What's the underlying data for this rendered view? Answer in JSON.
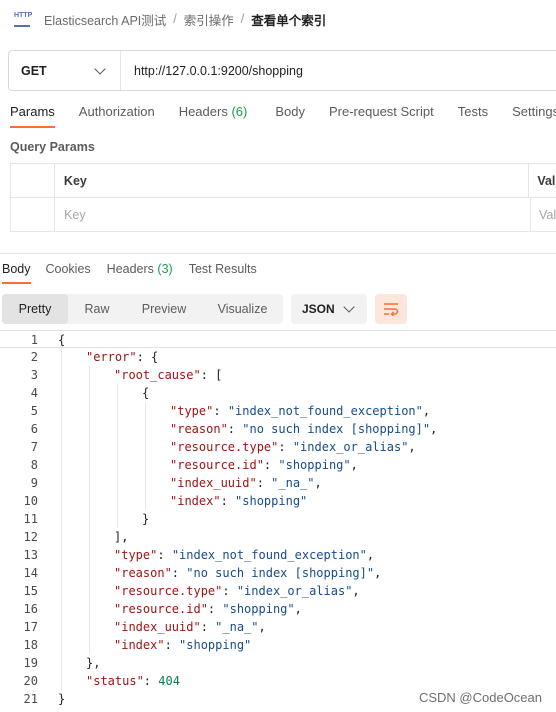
{
  "breadcrumb": {
    "badge": "HTTP",
    "items": [
      "Elasticsearch API测试",
      "索引操作"
    ],
    "separator": "/",
    "current": "查看单个索引"
  },
  "request": {
    "method": "GET",
    "url": "http://127.0.0.1:9200/shopping"
  },
  "request_tabs": [
    {
      "label": "Params",
      "active": true
    },
    {
      "label": "Authorization"
    },
    {
      "label": "Headers",
      "count": "(6)"
    },
    {
      "label": "Body"
    },
    {
      "label": "Pre-request Script"
    },
    {
      "label": "Tests"
    },
    {
      "label": "Settings"
    }
  ],
  "query_params": {
    "title": "Query Params",
    "headers": [
      "Key",
      "Value"
    ],
    "placeholders": [
      "Key",
      "Value"
    ]
  },
  "response_tabs": [
    {
      "label": "Body",
      "active": true
    },
    {
      "label": "Cookies"
    },
    {
      "label": "Headers",
      "count": "(3)"
    },
    {
      "label": "Test Results"
    }
  ],
  "view_modes": [
    "Pretty",
    "Raw",
    "Preview",
    "Visualize"
  ],
  "active_view": "Pretty",
  "format": "JSON",
  "icons": {
    "badge": "http-icon",
    "method": "chevron-down-icon",
    "format": "chevron-down-icon",
    "wrap": "wrap-lines-icon"
  },
  "colors": {
    "accent": "#ff6c37",
    "count": "#1a9e4b",
    "json_key": "#9c1313",
    "json_string": "#184c8a",
    "json_number": "#0d7a4e"
  },
  "code_lines": [
    [
      [
        "p",
        "{"
      ]
    ],
    [
      [
        "k",
        "\"error\""
      ],
      [
        "p",
        ": {"
      ]
    ],
    [
      [
        "k",
        "\"root_cause\""
      ],
      [
        "p",
        ": ["
      ]
    ],
    [
      [
        "p",
        "{"
      ]
    ],
    [
      [
        "k",
        "\"type\""
      ],
      [
        "p",
        ": "
      ],
      [
        "s",
        "\"index_not_found_exception\""
      ],
      [
        "p",
        ","
      ]
    ],
    [
      [
        "k",
        "\"reason\""
      ],
      [
        "p",
        ": "
      ],
      [
        "s",
        "\"no such index [shopping]\""
      ],
      [
        "p",
        ","
      ]
    ],
    [
      [
        "k",
        "\"resource.type\""
      ],
      [
        "p",
        ": "
      ],
      [
        "s",
        "\"index_or_alias\""
      ],
      [
        "p",
        ","
      ]
    ],
    [
      [
        "k",
        "\"resource.id\""
      ],
      [
        "p",
        ": "
      ],
      [
        "s",
        "\"shopping\""
      ],
      [
        "p",
        ","
      ]
    ],
    [
      [
        "k",
        "\"index_uuid\""
      ],
      [
        "p",
        ": "
      ],
      [
        "s",
        "\"_na_\""
      ],
      [
        "p",
        ","
      ]
    ],
    [
      [
        "k",
        "\"index\""
      ],
      [
        "p",
        ": "
      ],
      [
        "s",
        "\"shopping\""
      ]
    ],
    [
      [
        "p",
        "}"
      ]
    ],
    [
      [
        "p",
        "],"
      ]
    ],
    [
      [
        "k",
        "\"type\""
      ],
      [
        "p",
        ": "
      ],
      [
        "s",
        "\"index_not_found_exception\""
      ],
      [
        "p",
        ","
      ]
    ],
    [
      [
        "k",
        "\"reason\""
      ],
      [
        "p",
        ": "
      ],
      [
        "s",
        "\"no such index [shopping]\""
      ],
      [
        "p",
        ","
      ]
    ],
    [
      [
        "k",
        "\"resource.type\""
      ],
      [
        "p",
        ": "
      ],
      [
        "s",
        "\"index_or_alias\""
      ],
      [
        "p",
        ","
      ]
    ],
    [
      [
        "k",
        "\"resource.id\""
      ],
      [
        "p",
        ": "
      ],
      [
        "s",
        "\"shopping\""
      ],
      [
        "p",
        ","
      ]
    ],
    [
      [
        "k",
        "\"index_uuid\""
      ],
      [
        "p",
        ": "
      ],
      [
        "s",
        "\"_na_\""
      ],
      [
        "p",
        ","
      ]
    ],
    [
      [
        "k",
        "\"index\""
      ],
      [
        "p",
        ": "
      ],
      [
        "s",
        "\"shopping\""
      ]
    ],
    [
      [
        "p",
        "},"
      ]
    ],
    [
      [
        "k",
        "\"status\""
      ],
      [
        "p",
        ": "
      ],
      [
        "n",
        "404"
      ]
    ],
    [
      [
        "p",
        "}"
      ]
    ]
  ],
  "watermark": "CSDN @CodeOcean"
}
